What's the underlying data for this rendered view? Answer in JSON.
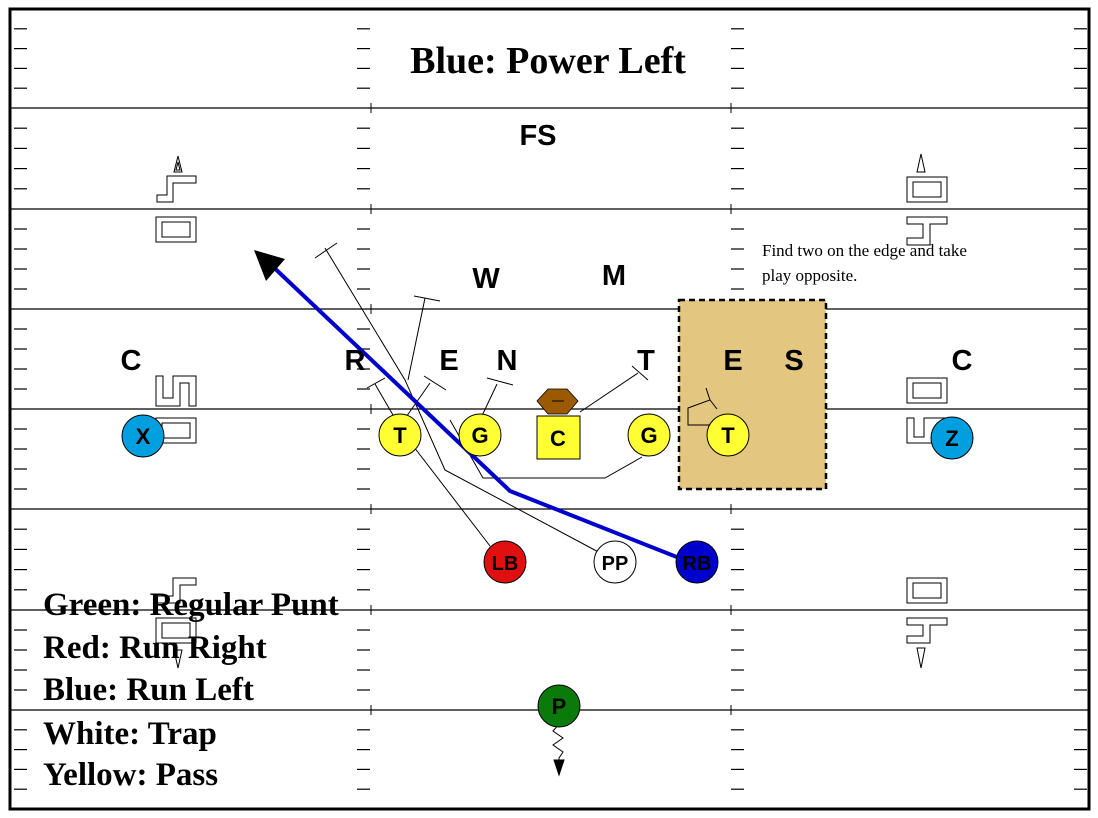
{
  "title": "Blue:  Power Left",
  "note": [
    "Find two on the edge and take",
    "play opposite."
  ],
  "legend": [
    {
      "color_name": "Green",
      "label": "Green:  Regular Punt"
    },
    {
      "color_name": "Red",
      "label": "Red:  Run Right"
    },
    {
      "color_name": "Blue",
      "label": "Blue:  Run Left"
    },
    {
      "color_name": "White",
      "label": "White:  Trap"
    },
    {
      "color_name": "Yellow",
      "label": "Yellow:  Pass"
    }
  ],
  "defense": [
    {
      "id": "fs",
      "label": "FS"
    },
    {
      "id": "w",
      "label": "W"
    },
    {
      "id": "m",
      "label": "M"
    },
    {
      "id": "c-left",
      "label": "C"
    },
    {
      "id": "r",
      "label": "R"
    },
    {
      "id": "e-left",
      "label": "E"
    },
    {
      "id": "n",
      "label": "N"
    },
    {
      "id": "t",
      "label": "T"
    },
    {
      "id": "e-right",
      "label": "E"
    },
    {
      "id": "s",
      "label": "S"
    },
    {
      "id": "c-right",
      "label": "C"
    }
  ],
  "offense": [
    {
      "id": "x",
      "label": "X",
      "color": "#00a0e0"
    },
    {
      "id": "t-left",
      "label": "T",
      "color": "#ffff33"
    },
    {
      "id": "g-left",
      "label": "G",
      "color": "#ffff33"
    },
    {
      "id": "c",
      "label": "C",
      "color": "#ffff33"
    },
    {
      "id": "g-right",
      "label": "G",
      "color": "#ffff33"
    },
    {
      "id": "t-right",
      "label": "T",
      "color": "#ffff33"
    },
    {
      "id": "z",
      "label": "Z",
      "color": "#00a0e0"
    },
    {
      "id": "lb",
      "label": "LB",
      "color": "#e01010"
    },
    {
      "id": "pp",
      "label": "PP",
      "color": "#ffffff"
    },
    {
      "id": "rb",
      "label": "RB",
      "color": "#0000cc"
    },
    {
      "id": "p",
      "label": "P",
      "color": "#0a7a0a"
    }
  ],
  "colors": {
    "route": "#0000cc",
    "highlight_zone": "#e3c67f",
    "ball": "#9b5a00"
  }
}
